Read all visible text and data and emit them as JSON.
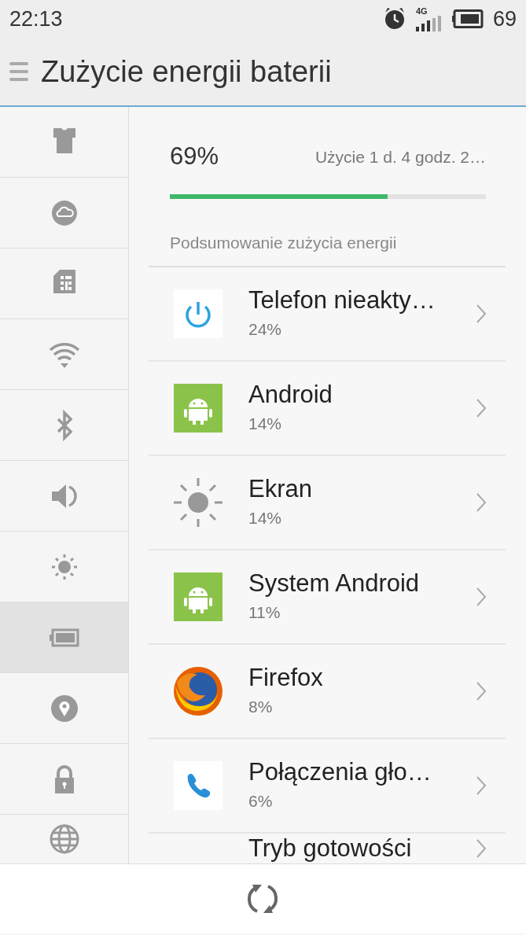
{
  "status_bar": {
    "time": "22:13",
    "network": "4G",
    "battery": "69"
  },
  "header": {
    "title": "Zużycie energii baterii"
  },
  "sidebar": {
    "items": [
      {
        "kind": "theme",
        "selected": false
      },
      {
        "kind": "cloud",
        "selected": false
      },
      {
        "kind": "sim",
        "selected": false
      },
      {
        "kind": "wifi",
        "selected": false
      },
      {
        "kind": "bluetooth",
        "selected": false
      },
      {
        "kind": "sound",
        "selected": false
      },
      {
        "kind": "brightness",
        "selected": false
      },
      {
        "kind": "battery",
        "selected": true
      },
      {
        "kind": "location",
        "selected": false
      },
      {
        "kind": "lock",
        "selected": false
      },
      {
        "kind": "globe",
        "selected": false
      }
    ]
  },
  "battery": {
    "percent": "69%",
    "usage": "Użycie 1 d. 4 godz. 2…",
    "level": 0.69
  },
  "summary": {
    "heading": "Podsumowanie zużycia energii",
    "items": [
      {
        "kind": "power",
        "name": "Telefon nieakty…",
        "percent": "24%"
      },
      {
        "kind": "android",
        "name": "Android",
        "percent": "14%"
      },
      {
        "kind": "screen",
        "name": "Ekran",
        "percent": "14%"
      },
      {
        "kind": "android",
        "name": "System Android",
        "percent": "11%"
      },
      {
        "kind": "firefox",
        "name": "Firefox",
        "percent": "8%"
      },
      {
        "kind": "phone",
        "name": "Połączenia gło…",
        "percent": "6%"
      },
      {
        "kind": "standby",
        "name": "Tryb gotowości"
      }
    ]
  }
}
